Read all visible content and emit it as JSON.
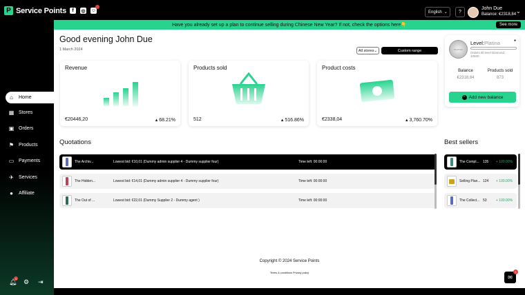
{
  "header": {
    "brand": "Service Points",
    "brand_logo": "P",
    "language": "English",
    "help_label": "?",
    "user_name": "John Due",
    "user_balance": "Balance: €2318,84",
    "social_icons": [
      "facebook-icon",
      "instagram-icon",
      "discord-icon"
    ]
  },
  "banner": {
    "text": "Have you already set up a plan to continue selling during Chinese New Year? If not, check the options here👇",
    "see_more": "See more"
  },
  "sidebar": {
    "items": [
      {
        "label": "Home",
        "icon": "home-icon"
      },
      {
        "label": "Stores",
        "icon": "store-icon"
      },
      {
        "label": "Orders",
        "icon": "orders-icon"
      },
      {
        "label": "Products",
        "icon": "products-icon"
      },
      {
        "label": "Payments",
        "icon": "payments-icon"
      },
      {
        "label": "Services",
        "icon": "services-icon"
      },
      {
        "label": "Affiliate",
        "icon": "affiliate-icon"
      }
    ],
    "active": "Home"
  },
  "main": {
    "greeting": "Good evening John Due",
    "date": "1 March 2024",
    "filter": "All stores",
    "range": "Custom range"
  },
  "cards": [
    {
      "title": "Revenue",
      "value": "€20446,20",
      "change": "68.21%",
      "icon": "bar-chart-icon"
    },
    {
      "title": "Products sold",
      "value": "512",
      "change": "516.86%",
      "icon": "basket-icon"
    },
    {
      "title": "Product costs",
      "value": "€2338,04",
      "change": "3,760.70%",
      "icon": "cash-icon"
    }
  ],
  "quotations": {
    "title": "Quotations",
    "rows": [
      {
        "name": "The Archiv...",
        "bid": "Lowest bid: €10,01 (Dummy admin supplier 4 - Dummy supplier four)",
        "time": "Time left: 00:00:00"
      },
      {
        "name": "The Hidden...",
        "bid": "Lowest bid: €14,01 (Dummy admin supplier 4 - Dummy supplier four)",
        "time": "Time left: 00:00:00"
      },
      {
        "name": "The Out of ...",
        "bid": "Lowest bid: €22,01 (Dummy Supplier 2 - Dummy agent )",
        "time": "Time left: 00:00:00"
      }
    ]
  },
  "best_sellers": {
    "title": "Best sellers",
    "rows": [
      {
        "name": "The Compl...",
        "count": "135",
        "change": "+ 100.00%"
      },
      {
        "name": "Selling Plan...",
        "count": "124",
        "change": "+ 100.00%"
      },
      {
        "name": "The Collect...",
        "count": "53",
        "change": "+ 100.00%"
      }
    ]
  },
  "balance_card": {
    "level_label": "Level:",
    "level_value": "Platina",
    "level_note": "Orders till level Diamond",
    "level_count": "10500",
    "medal_text": "PLATINA",
    "balance_label": "Balance",
    "balance_value": "€2318,84",
    "sold_label": "Products sold",
    "sold_value": "873",
    "add_label": "Add new balance"
  },
  "footer": {
    "copyright": "Copyright © 2024 Service Points",
    "terms": "Terms & conditions  Privacy policy"
  },
  "chat": {
    "badge": "1"
  },
  "notifications": {
    "badge": "3"
  },
  "colors": {
    "accent": "#27d38f",
    "dark": "#000000",
    "positive": "#27a860"
  }
}
